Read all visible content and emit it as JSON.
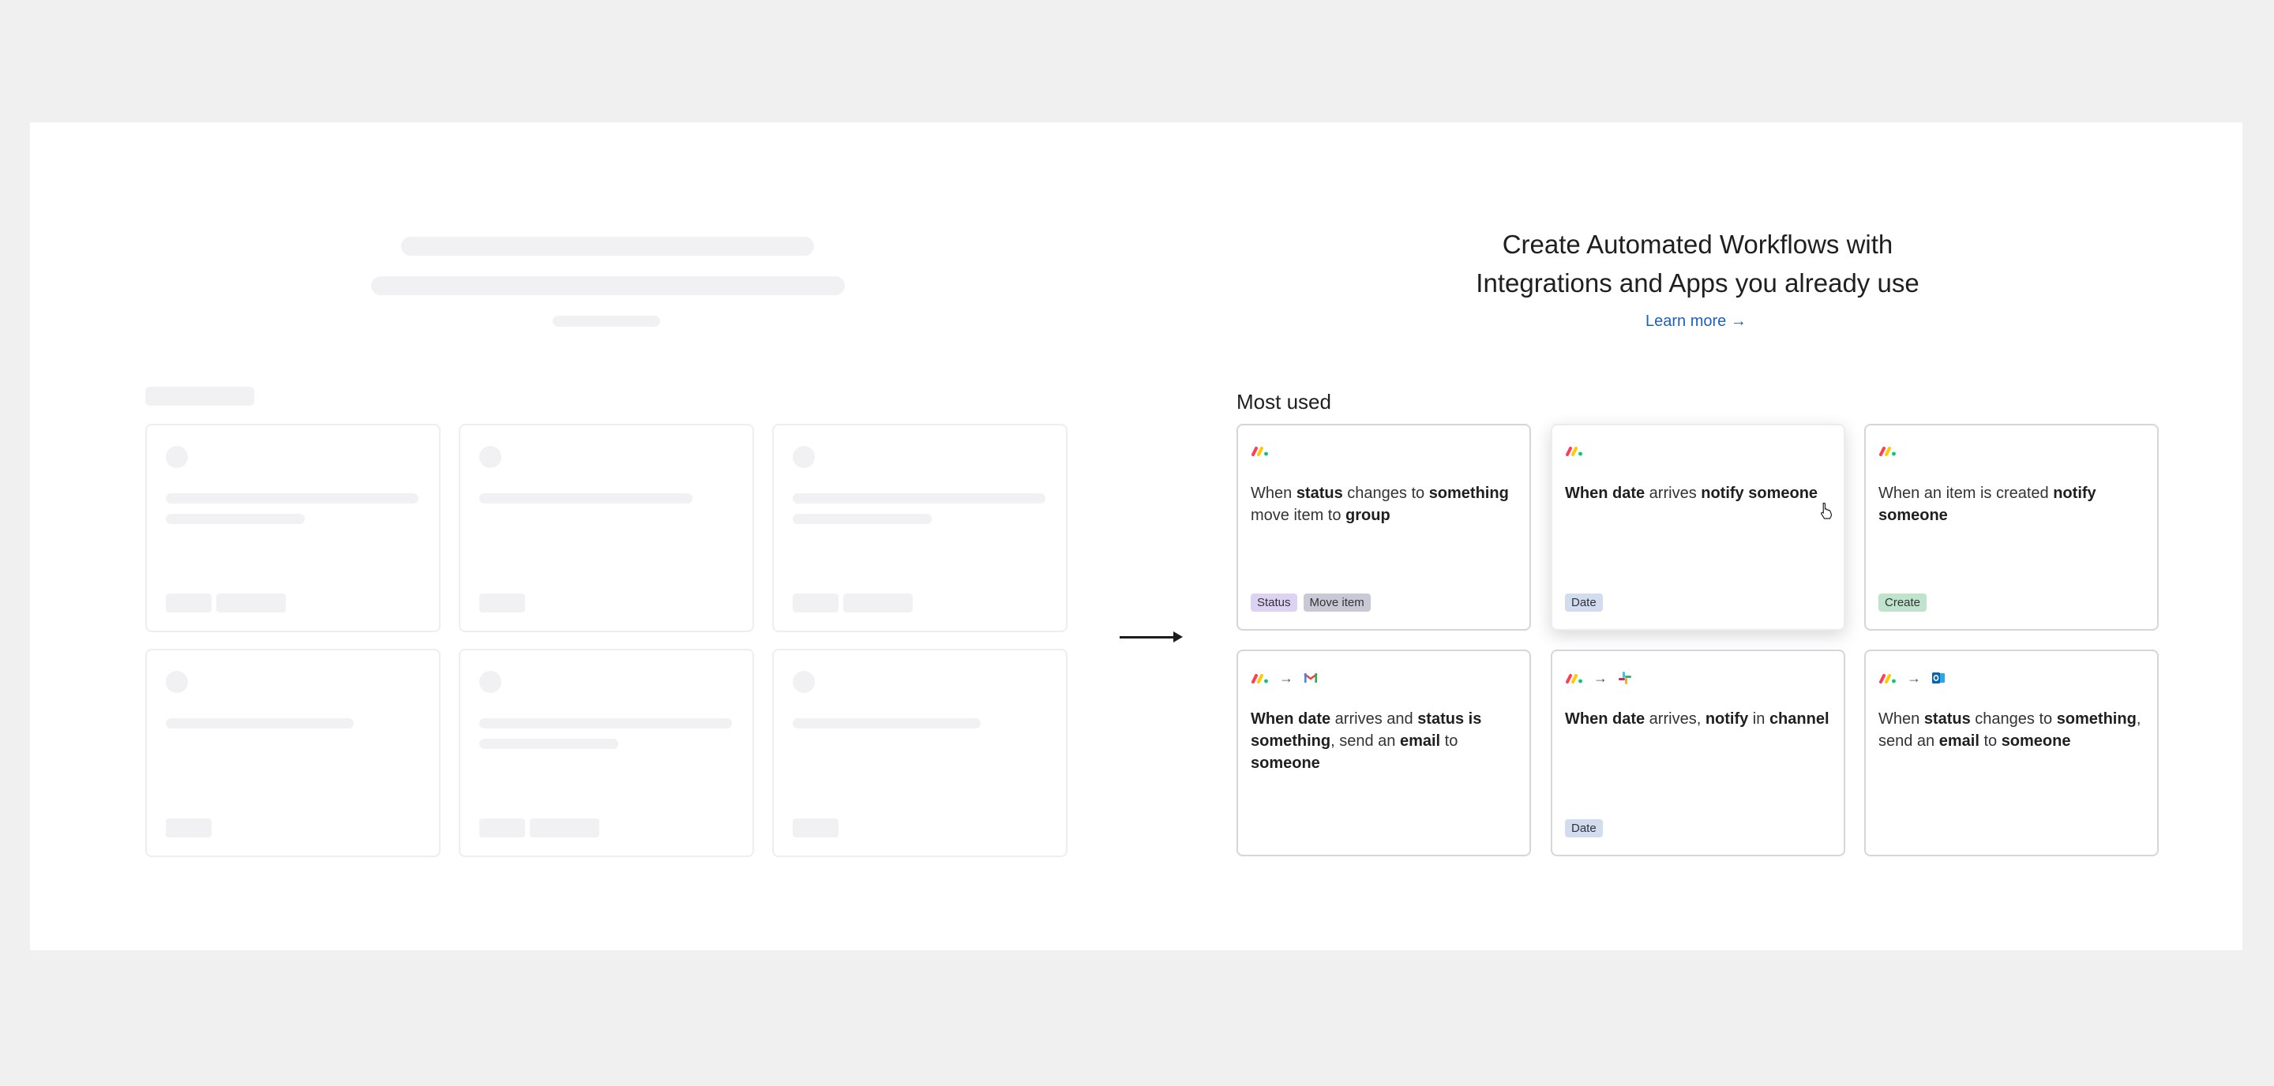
{
  "headline": {
    "line1": "Create Automated Workflows with",
    "line2": "Integrations and Apps you already use",
    "learn_more": "Learn more →"
  },
  "section_title": "Most used",
  "colors": {
    "tag_status": "#dcd2f2",
    "tag_move_item": "#c9c9d6",
    "tag_date": "#d2dcef",
    "tag_create": "#bfe3cc",
    "link": "#1f5fbf"
  },
  "cards": [
    {
      "icons": [
        "monday-logo"
      ],
      "parts": [
        {
          "t": "When ",
          "b": false
        },
        {
          "t": "status",
          "b": true
        },
        {
          "t": " changes to ",
          "b": false
        },
        {
          "t": "something",
          "b": true
        },
        {
          "t": " move item to ",
          "b": false
        },
        {
          "t": "group",
          "b": true
        }
      ],
      "tags": [
        {
          "label": "Status",
          "color": "#dcd2f2"
        },
        {
          "label": "Move item",
          "color": "#c9c9d6"
        }
      ]
    },
    {
      "icons": [
        "monday-logo"
      ],
      "parts": [
        {
          "t": "When date",
          "b": true
        },
        {
          "t": " arrives ",
          "b": false
        },
        {
          "t": "notify someone",
          "b": true
        }
      ],
      "tags": [
        {
          "label": "Date",
          "color": "#d2dcef"
        }
      ]
    },
    {
      "icons": [
        "monday-logo"
      ],
      "parts": [
        {
          "t": "When an item is created ",
          "b": false
        },
        {
          "t": "notify someone",
          "b": true
        }
      ],
      "tags": [
        {
          "label": "Create",
          "color": "#bfe3cc"
        }
      ]
    },
    {
      "icons": [
        "monday-logo",
        "arrow",
        "gmail-icon"
      ],
      "parts": [
        {
          "t": "When date",
          "b": true
        },
        {
          "t": " arrives and ",
          "b": false
        },
        {
          "t": "status is something",
          "b": true
        },
        {
          "t": ", send an ",
          "b": false
        },
        {
          "t": "email",
          "b": true
        },
        {
          "t": " to ",
          "b": false
        },
        {
          "t": "someone",
          "b": true
        }
      ],
      "tags": []
    },
    {
      "icons": [
        "monday-logo",
        "arrow",
        "slack-icon"
      ],
      "parts": [
        {
          "t": "When date",
          "b": true
        },
        {
          "t": " arrives, ",
          "b": false
        },
        {
          "t": "notify",
          "b": true
        },
        {
          "t": " in ",
          "b": false
        },
        {
          "t": "channel",
          "b": true
        }
      ],
      "tags": [
        {
          "label": "Date",
          "color": "#d2dcef"
        }
      ]
    },
    {
      "icons": [
        "monday-logo",
        "arrow",
        "outlook-icon"
      ],
      "parts": [
        {
          "t": "When ",
          "b": false
        },
        {
          "t": "status",
          "b": true
        },
        {
          "t": " changes to ",
          "b": false
        },
        {
          "t": "something",
          "b": true
        },
        {
          "t": ", send an ",
          "b": false
        },
        {
          "t": "email",
          "b": true
        },
        {
          "t": " to ",
          "b": false
        },
        {
          "t": "someone",
          "b": true
        }
      ],
      "tags": []
    }
  ]
}
